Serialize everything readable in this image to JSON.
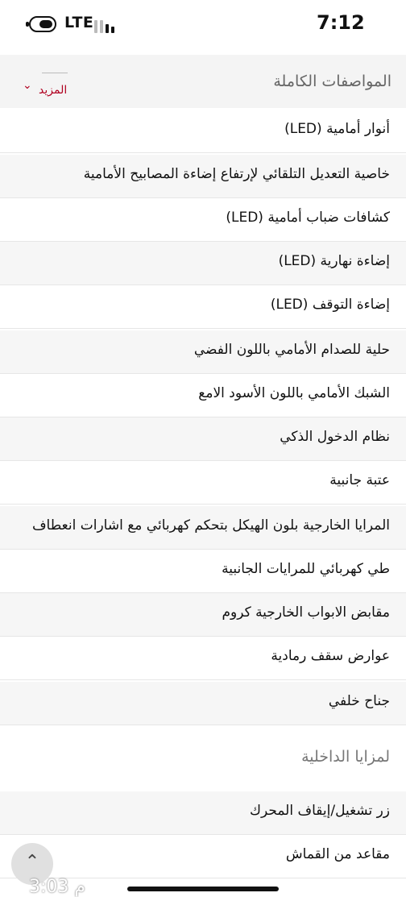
{
  "status_bar": {
    "network": "LTE",
    "time": "7:12"
  },
  "section": {
    "title": "المواصفات الكاملة",
    "more_label": "المزيد"
  },
  "specs": [
    "أنوار أمامية (LED)",
    "خاصية التعديل التلقائي لإرتفاع إضاءة المصابيح الأمامية",
    "كشافات ضباب أمامية (LED)",
    "إضاءة نهارية (LED)",
    "إضاءة التوقف (LED)",
    "حلية للصدام الأمامي باللون الفضي",
    "الشبك الأمامي باللون الأسود الامع",
    "نظام الدخول الذكي",
    "عتبة جانبية",
    "المرايا الخارجية بلون الهيكل بتحكم كهربائي مع اشارات انعطاف",
    "طي كهربائي للمرايات الجانبية",
    "مقابض الابواب الخارجية كروم",
    "عوارض سقف رمادية",
    "جناح خلفي"
  ],
  "interior": {
    "title": "لمزايا الداخلية",
    "items": [
      "زر تشغيل/إيقاف المحرك",
      "مقاعد من القماش"
    ]
  },
  "overlay": {
    "time": "3:03 م"
  },
  "icons": {
    "scroll": "chevron-up-icon",
    "more": "chevron-down-icon",
    "battery": "battery-icon",
    "signal": "signal-icon"
  },
  "colors": {
    "accent": "#b00020",
    "alt_row": "#f6f6f6"
  }
}
